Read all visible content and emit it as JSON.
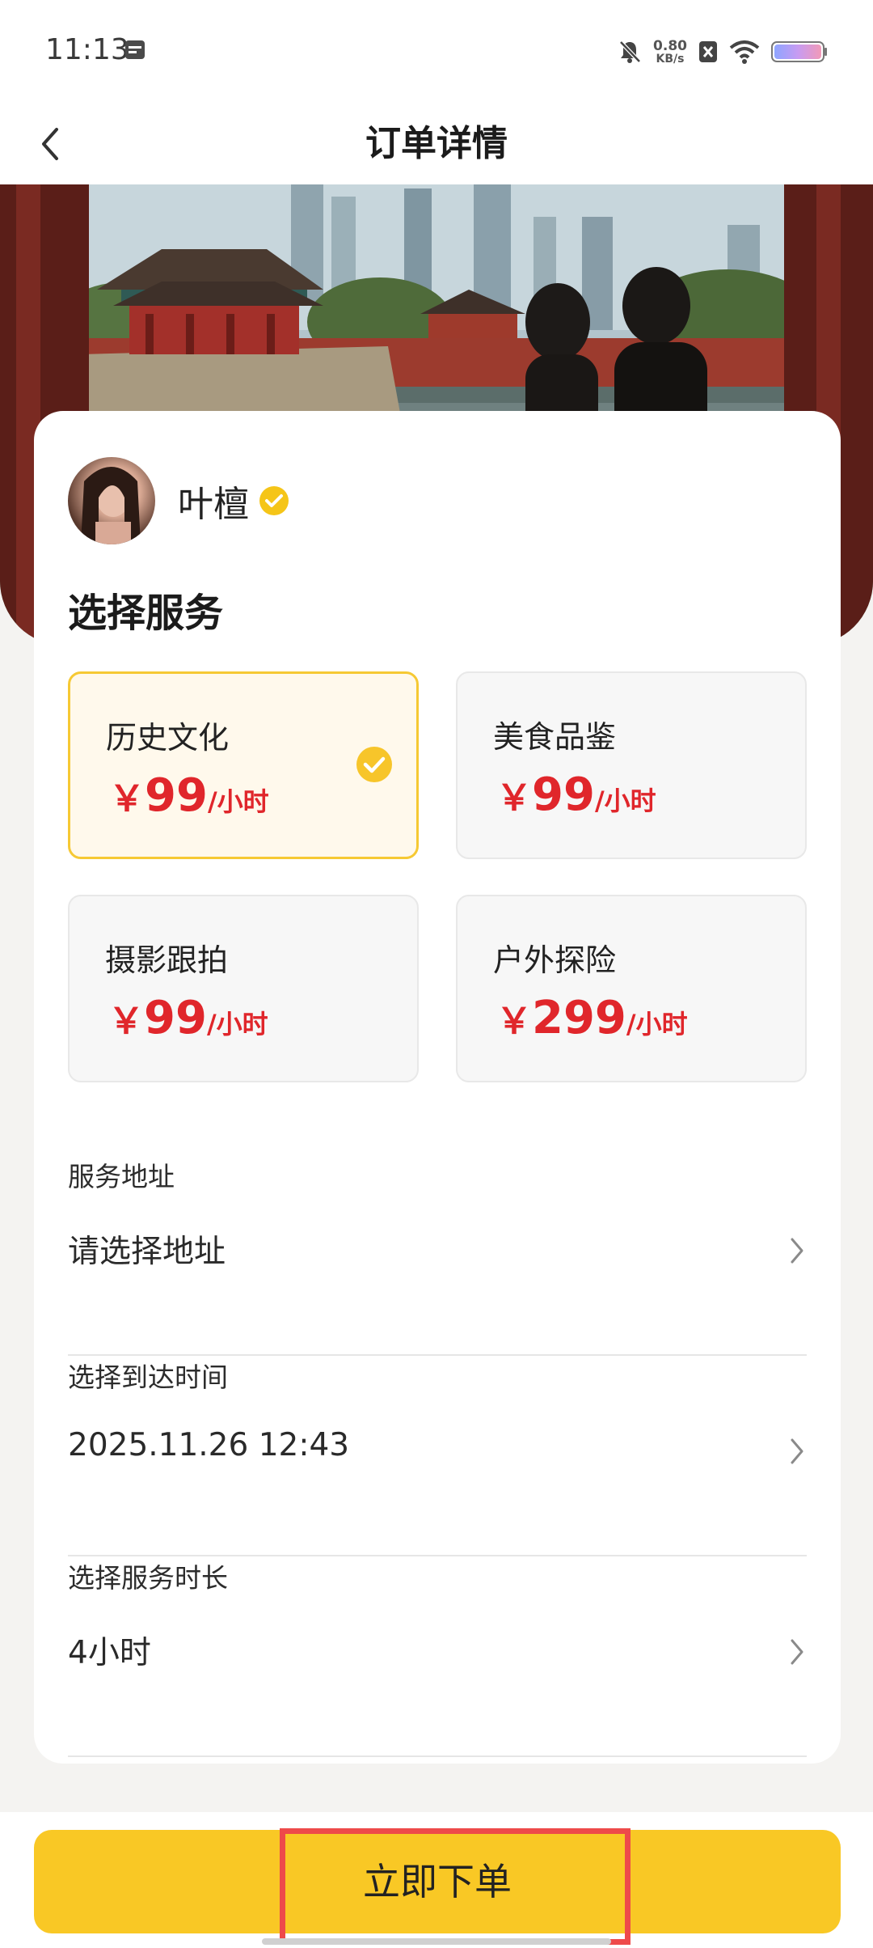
{
  "status_bar": {
    "time": "11:13",
    "net_speed_value": "0.80",
    "net_speed_unit": "KB/s",
    "icons": [
      "calendar-icon",
      "mute-icon",
      "sim-off-icon",
      "wifi-icon",
      "battery-icon"
    ]
  },
  "header": {
    "title": "订单详情",
    "back_icon": "chevron-left-icon"
  },
  "provider": {
    "name": "叶檀",
    "verified": true
  },
  "services": {
    "title": "选择服务",
    "items": [
      {
        "name": "历史文化",
        "currency": "￥",
        "price": "99",
        "unit": "/小时",
        "selected": true
      },
      {
        "name": "美食品鉴",
        "currency": "￥",
        "price": "99",
        "unit": "/小时",
        "selected": false
      },
      {
        "name": "摄影跟拍",
        "currency": "￥",
        "price": "99",
        "unit": "/小时",
        "selected": false
      },
      {
        "name": "户外探险",
        "currency": "￥",
        "price": "299",
        "unit": "/小时",
        "selected": false
      }
    ]
  },
  "fields": {
    "address": {
      "label": "服务地址",
      "value": "请选择地址"
    },
    "arrival_time": {
      "label": "选择到达时间",
      "value": "2025.11.26 12:43"
    },
    "duration": {
      "label": "选择服务时长",
      "value": "4小时"
    }
  },
  "actions": {
    "order_label": "立即下单"
  },
  "colors": {
    "accent": "#f9c825",
    "price": "#e0262b",
    "selected_bg": "#fff9ec",
    "highlight": "#ee4a4a"
  }
}
